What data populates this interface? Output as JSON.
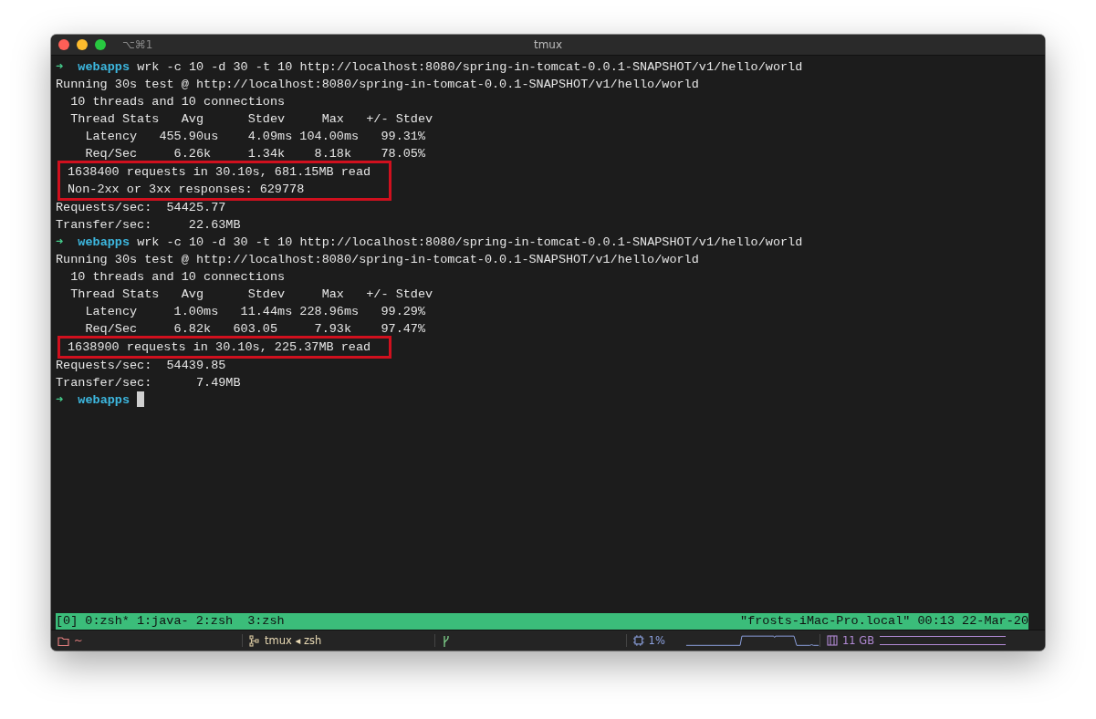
{
  "window": {
    "shortcut": "⌥⌘1",
    "title": "tmux"
  },
  "terminal": {
    "lines": [
      {
        "kind": "prompt",
        "arrow": "➜",
        "dir": "webapps",
        "command": "wrk -c 10 -d 30 -t 10 http://localhost:8080/spring-in-tomcat-0.0.1-SNAPSHOT/v1/hello/world",
        "cursor": false
      },
      {
        "kind": "output",
        "text": "Running 30s test @ http://localhost:8080/spring-in-tomcat-0.0.1-SNAPSHOT/v1/hello/world"
      },
      {
        "kind": "output",
        "text": "  10 threads and 10 connections"
      },
      {
        "kind": "output",
        "text": "  Thread Stats   Avg      Stdev     Max   +/- Stdev"
      },
      {
        "kind": "output",
        "text": "    Latency   455.90us    4.09ms 104.00ms   99.31%"
      },
      {
        "kind": "output",
        "text": "    Req/Sec     6.26k     1.34k    8.18k    78.05%"
      },
      {
        "kind": "boxed",
        "lines": [
          "1638400 requests in 30.10s, 681.15MB read",
          "Non-2xx or 3xx responses: 629778"
        ]
      },
      {
        "kind": "output",
        "text": "Requests/sec:  54425.77"
      },
      {
        "kind": "output",
        "text": "Transfer/sec:     22.63MB"
      },
      {
        "kind": "prompt",
        "arrow": "➜",
        "dir": "webapps",
        "command": "wrk -c 10 -d 30 -t 10 http://localhost:8080/spring-in-tomcat-0.0.1-SNAPSHOT/v1/hello/world",
        "cursor": false
      },
      {
        "kind": "output",
        "text": "Running 30s test @ http://localhost:8080/spring-in-tomcat-0.0.1-SNAPSHOT/v1/hello/world"
      },
      {
        "kind": "output",
        "text": "  10 threads and 10 connections"
      },
      {
        "kind": "output",
        "text": "  Thread Stats   Avg      Stdev     Max   +/- Stdev"
      },
      {
        "kind": "output",
        "text": "    Latency     1.00ms   11.44ms 228.96ms   99.29%"
      },
      {
        "kind": "output",
        "text": "    Req/Sec     6.82k   603.05     7.93k    97.47%"
      },
      {
        "kind": "boxed",
        "lines": [
          "1638900 requests in 30.10s, 225.37MB read"
        ]
      },
      {
        "kind": "output",
        "text": "Requests/sec:  54439.85"
      },
      {
        "kind": "output",
        "text": "Transfer/sec:      7.49MB"
      },
      {
        "kind": "prompt",
        "arrow": "➜",
        "dir": "webapps",
        "cursor": true
      }
    ]
  },
  "tmux_bar": {
    "session": "[0]",
    "windows": [
      "0:zsh*",
      "1:java-",
      "2:zsh",
      "3:zsh"
    ],
    "right": "\"frosts-iMac-Pro.local\" 00:13 22-Mar-20"
  },
  "status_bar": {
    "directory": "~",
    "session": "tmux ◂ zsh",
    "cpu": "1%",
    "memory": "11 GB"
  }
}
